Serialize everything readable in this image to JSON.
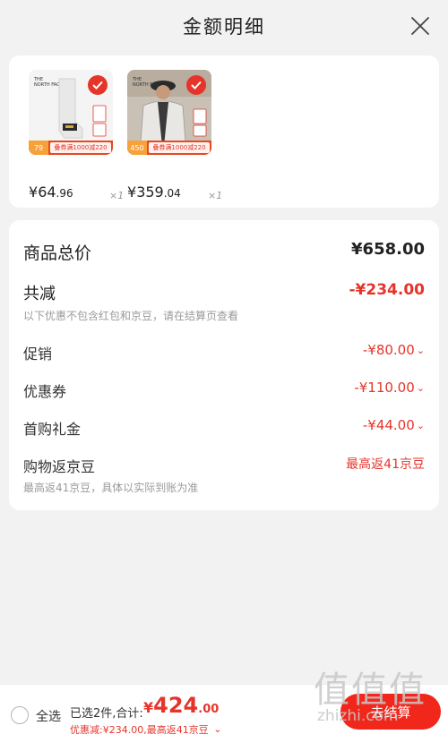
{
  "header": {
    "title": "金额明细"
  },
  "products": [
    {
      "name": "袜子",
      "brand_logo": "THE NORTH FACE",
      "promo_price": "79",
      "promo_text": "叠券满1000减220",
      "price_symbol": "¥",
      "price_int": "64",
      "price_dec": ".96",
      "quantity": "×1",
      "image_colors": {
        "bg": "#f3f3f3",
        "item": "#e9e9e9",
        "accent": "#222222"
      }
    },
    {
      "name": "外套",
      "brand_logo": "THE NORTH FACE",
      "promo_price": "450",
      "promo_text": "叠券满1000减220",
      "price_symbol": "¥",
      "price_int": "359",
      "price_dec": ".04",
      "quantity": "×1",
      "image_colors": {
        "bg": "#c9c1b6",
        "item": "#e8e6e2",
        "accent": "#2b2b2b"
      }
    }
  ],
  "details": {
    "goods_total_label": "商品总价",
    "goods_total_value": "¥658.00",
    "total_reduce_label": "共减",
    "total_reduce_value": "-¥234.00",
    "reduce_note": "以下优惠不包含红包和京豆，请在结算页查看",
    "promotion_label": "促销",
    "promotion_value": "-¥80.00",
    "coupon_label": "优惠券",
    "coupon_value": "-¥110.00",
    "first_gift_label": "首购礼金",
    "first_gift_value": "-¥44.00",
    "bean_label": "购物返京豆",
    "bean_value": "最高返41京豆",
    "bean_note": "最高返41京豆，具体以实际到账为准"
  },
  "bottom_bar": {
    "select_all_label": "全选",
    "selected_summary": "已选2件,合计:",
    "total_symbol": "¥",
    "total_int": "424",
    "total_dec": ".00",
    "discount_summary": "优惠减:¥234.00,最高返41京豆",
    "checkout_label": "去结算"
  },
  "watermark": {
    "glyphs": "值值值",
    "site": "zhizhi.com"
  },
  "colors": {
    "accent_red": "#e5352b",
    "checkout_red": "#f2271c",
    "background": "#f2f2f2",
    "card": "#ffffff"
  }
}
